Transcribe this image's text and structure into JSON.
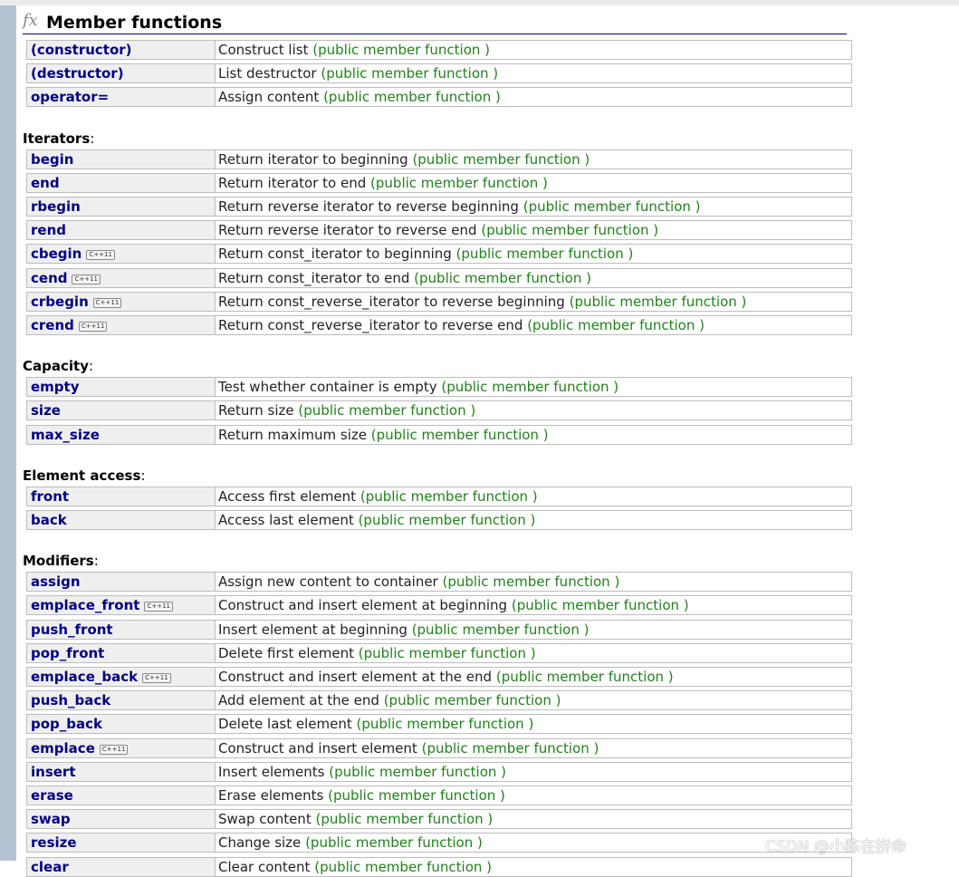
{
  "header": {
    "icon": "fx",
    "title": "Member functions"
  },
  "kind_label": "(public member function )",
  "groups": [
    {
      "section": "",
      "rows": [
        {
          "name": "(constructor)",
          "desc": "Construct list",
          "cpp11": false
        },
        {
          "name": "(destructor)",
          "desc": "List destructor",
          "cpp11": false
        },
        {
          "name": "operator=",
          "desc": "Assign content",
          "cpp11": false
        }
      ]
    },
    {
      "section": "Iterators",
      "rows": [
        {
          "name": "begin",
          "desc": "Return iterator to beginning",
          "cpp11": false
        },
        {
          "name": "end",
          "desc": "Return iterator to end",
          "cpp11": false
        },
        {
          "name": "rbegin",
          "desc": "Return reverse iterator to reverse beginning",
          "cpp11": false
        },
        {
          "name": "rend",
          "desc": "Return reverse iterator to reverse end",
          "cpp11": false
        },
        {
          "name": "cbegin",
          "desc": "Return const_iterator to beginning",
          "cpp11": true
        },
        {
          "name": "cend",
          "desc": "Return const_iterator to end",
          "cpp11": true
        },
        {
          "name": "crbegin",
          "desc": "Return const_reverse_iterator to reverse beginning",
          "cpp11": true
        },
        {
          "name": "crend",
          "desc": "Return const_reverse_iterator to reverse end",
          "cpp11": true
        }
      ]
    },
    {
      "section": "Capacity",
      "rows": [
        {
          "name": "empty",
          "desc": "Test whether container is empty",
          "cpp11": false
        },
        {
          "name": "size",
          "desc": "Return size",
          "cpp11": false
        },
        {
          "name": "max_size",
          "desc": "Return maximum size",
          "cpp11": false
        }
      ]
    },
    {
      "section": "Element access",
      "rows": [
        {
          "name": "front",
          "desc": "Access first element",
          "cpp11": false
        },
        {
          "name": "back",
          "desc": "Access last element",
          "cpp11": false
        }
      ]
    },
    {
      "section": "Modifiers",
      "rows": [
        {
          "name": "assign",
          "desc": "Assign new content to container",
          "cpp11": false
        },
        {
          "name": "emplace_front",
          "desc": "Construct and insert element at beginning",
          "cpp11": true
        },
        {
          "name": "push_front",
          "desc": "Insert element at beginning",
          "cpp11": false
        },
        {
          "name": "pop_front",
          "desc": "Delete first element",
          "cpp11": false
        },
        {
          "name": "emplace_back",
          "desc": "Construct and insert element at the end",
          "cpp11": true
        },
        {
          "name": "push_back",
          "desc": "Add element at the end",
          "cpp11": false
        },
        {
          "name": "pop_back",
          "desc": "Delete last element",
          "cpp11": false
        },
        {
          "name": "emplace",
          "desc": "Construct and insert element",
          "cpp11": true
        },
        {
          "name": "insert",
          "desc": "Insert elements",
          "cpp11": false
        },
        {
          "name": "erase",
          "desc": "Erase elements",
          "cpp11": false
        },
        {
          "name": "swap",
          "desc": "Swap content",
          "cpp11": false
        },
        {
          "name": "resize",
          "desc": "Change size",
          "cpp11": false
        },
        {
          "name": "clear",
          "desc": "Clear content",
          "cpp11": false
        }
      ]
    }
  ],
  "badge_label": "C++11",
  "watermark": "CSDN @小陈在拼命",
  "colors": {
    "name": "#000080",
    "kind": "#22801c",
    "name_bg": "#efefef",
    "sidebar": "#b4c2d2"
  }
}
